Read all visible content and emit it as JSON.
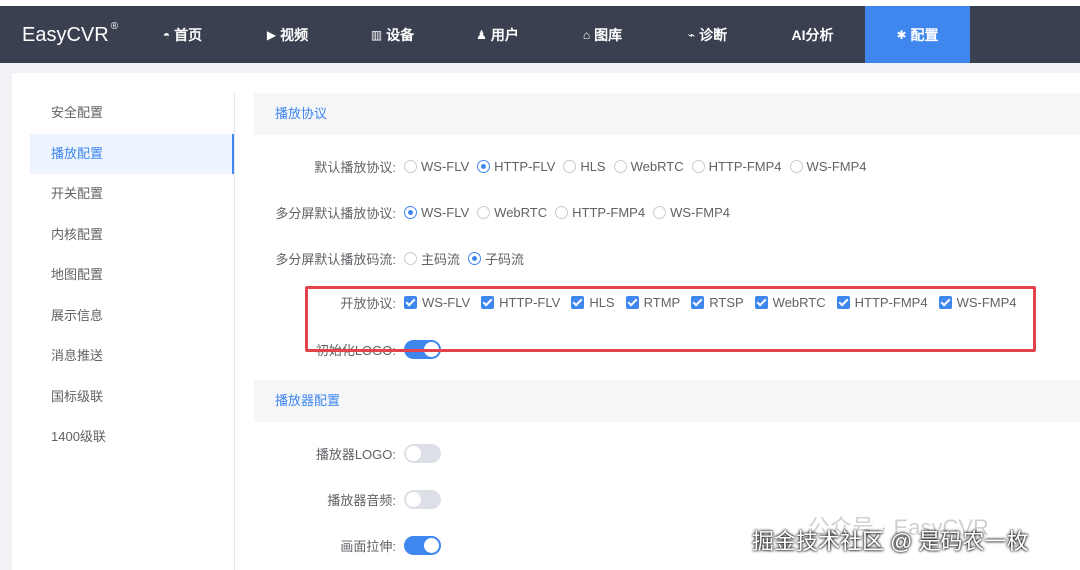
{
  "brand": "EasyCVR",
  "brand_mark": "®",
  "nav": [
    {
      "label": "首页",
      "icon": "dashboard-icon",
      "glyph": "◓"
    },
    {
      "label": "视频",
      "icon": "play-icon",
      "glyph": "▶"
    },
    {
      "label": "设备",
      "icon": "device-icon",
      "glyph": "▥"
    },
    {
      "label": "用户",
      "icon": "user-icon",
      "glyph": "♟"
    },
    {
      "label": "图库",
      "icon": "gallery-icon",
      "glyph": "⌂"
    },
    {
      "label": "诊断",
      "icon": "diagnosis-icon",
      "glyph": "⌁"
    },
    {
      "label": "AI分析",
      "icon": "",
      "glyph": ""
    },
    {
      "label": "配置",
      "icon": "gear-icon",
      "glyph": "✱"
    }
  ],
  "sidebar": [
    "安全配置",
    "播放配置",
    "开关配置",
    "内核配置",
    "地图配置",
    "展示信息",
    "消息推送",
    "国标级联",
    "1400级联"
  ],
  "sections": {
    "play_protocol": "播放协议",
    "player_config": "播放器配置"
  },
  "rows": {
    "default_protocol": {
      "label": "默认播放协议:",
      "options": [
        "WS-FLV",
        "HTTP-FLV",
        "HLS",
        "WebRTC",
        "HTTP-FMP4",
        "WS-FMP4"
      ],
      "selected": "HTTP-FLV"
    },
    "multi_protocol": {
      "label": "多分屏默认播放协议:",
      "options": [
        "WS-FLV",
        "WebRTC",
        "HTTP-FMP4",
        "WS-FMP4"
      ],
      "selected": "WS-FLV"
    },
    "multi_stream": {
      "label": "多分屏默认播放码流:",
      "options": [
        "主码流",
        "子码流"
      ],
      "selected": "子码流"
    },
    "open_protocol": {
      "label": "开放协议:",
      "options": [
        "WS-FLV",
        "HTTP-FLV",
        "HLS",
        "RTMP",
        "RTSP",
        "WebRTC",
        "HTTP-FMP4",
        "WS-FMP4"
      ]
    },
    "init_logo": {
      "label": "初始化LOGO:",
      "on": true
    },
    "player_logo": {
      "label": "播放器LOGO:",
      "on": false
    },
    "player_audio": {
      "label": "播放器音频:",
      "on": false
    },
    "stretch": {
      "label": "画面拉伸:",
      "on": true
    }
  },
  "watermark": {
    "faint": "公众号 · EasyCVR",
    "main": "掘金技术社区 @ 是码农一枚"
  }
}
